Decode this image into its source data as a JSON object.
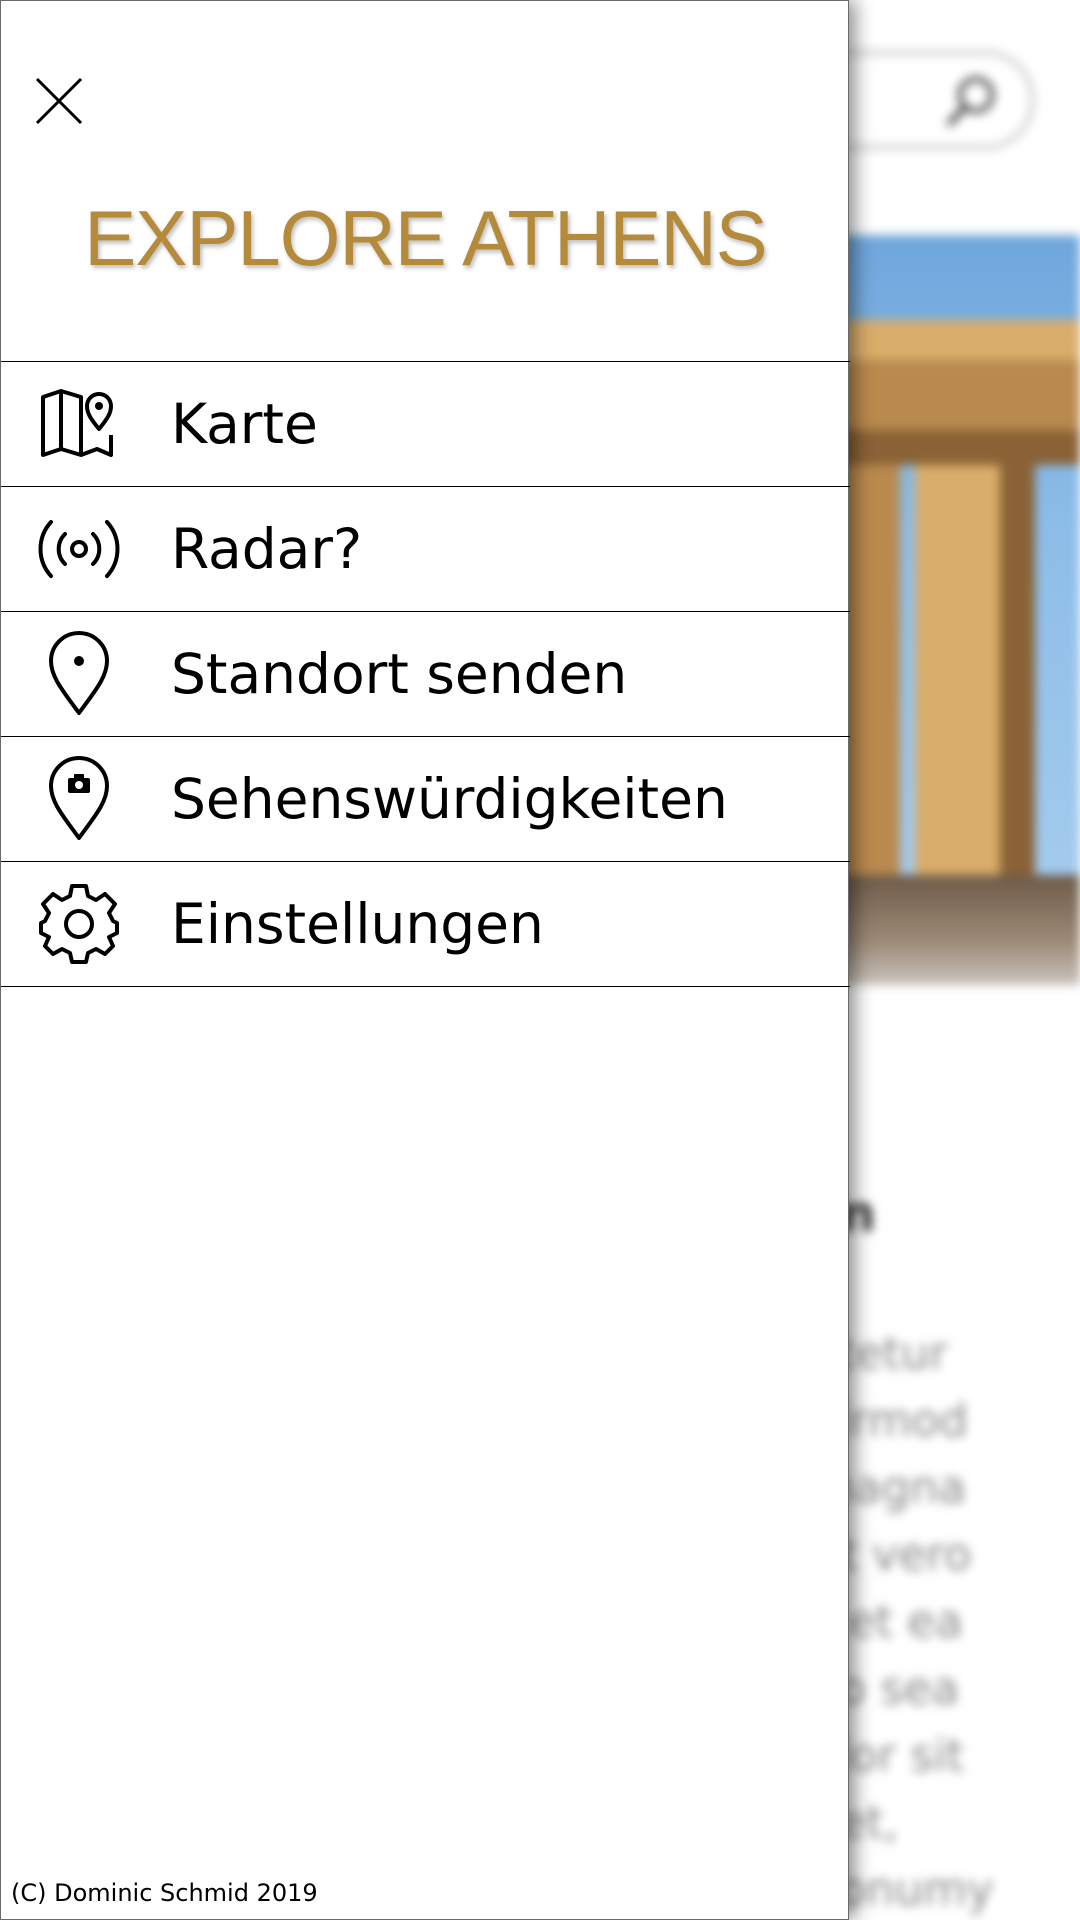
{
  "drawer": {
    "title": "EXPLORE ATHENS",
    "title_color": "#b58a3b",
    "close_icon": "close-icon",
    "menu": [
      {
        "label": "Karte",
        "icon": "map-pin-icon"
      },
      {
        "label": "Radar?",
        "icon": "radar-icon"
      },
      {
        "label": "Standort senden",
        "icon": "location-pin-icon"
      },
      {
        "label": "Sehenswürdigkeiten",
        "icon": "camera-pin-icon"
      },
      {
        "label": "Einstellungen",
        "icon": "gear-icon"
      }
    ],
    "footer": "(C) Dominic Schmid 2019"
  },
  "background": {
    "search_icon": "search-icon",
    "heading_fragment": "n",
    "text_fragments": [
      "etetur",
      "eirmod",
      "magna",
      "At vero",
      "s et ea",
      "no sea",
      "olor sit",
      "net,",
      "nonumy"
    ]
  }
}
